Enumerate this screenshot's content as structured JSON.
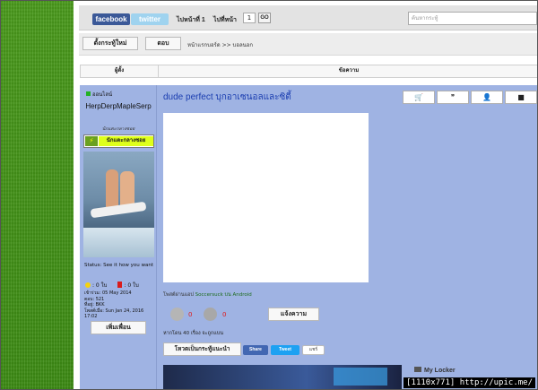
{
  "social": {
    "facebook": "facebook",
    "twitter": "twitter"
  },
  "pagination": {
    "page_info": "ไปหน้าที่ 1",
    "goto_label": "ไปที่หน้า",
    "page_value": "1",
    "go_label": "GO"
  },
  "search": {
    "placeholder": "ค้นหากระทู้"
  },
  "nav": {
    "new_topic": "ตั้งกระทู้ใหม่",
    "reply": "ตอบ",
    "breadcrumb": "หน้าแรกบอร์ด >> บอลนอก"
  },
  "table_header": {
    "author": "ผู้ตั้ง",
    "message": "ข้อความ"
  },
  "profile": {
    "online_label": "ออนไลน์",
    "username": "HerpDerpMapleSerp",
    "rank": "นักแตะกลางซอย",
    "rank_badge": "นักแตะกลางซอย",
    "status": "Status: See it how you want",
    "gold": ": 0 ใบ",
    "red": ": 0 ใบ",
    "joined": "เข้าร่วม: 05 May 2014",
    "posts": "ตอบ: 521",
    "location": "ที่อยู่: BKK",
    "last_post": "โพสต์เมื่อ: Sun Jan 24, 2016 17:02",
    "add_friend": "เพิ่มเพื่อน"
  },
  "post": {
    "title": "dude perfect บุกอาเซนอลและซิตี้",
    "posted_from_prefix": "โพสต์ผ่านแอป ",
    "posted_from_app": "Soccersuck บน Android",
    "like_count": "0",
    "dislike_count": "0",
    "report_label": "แจ้งความ",
    "comeback_text": "หากโดน 40 เรื่อง จะถูกแบน",
    "promote_label": "โหวตเป็นกระทู้แนะนำ",
    "share_fb": "Share",
    "share_tw": "Tweet",
    "share_gp": "แชร์",
    "locker_label": "My Locker"
  },
  "tools": {
    "cart_icon": "cart-icon",
    "quote_icon": "quote-icon",
    "user_icon": "user-icon",
    "message_icon": "message-icon"
  },
  "watermark": "[1110x771] http://upic.me/"
}
